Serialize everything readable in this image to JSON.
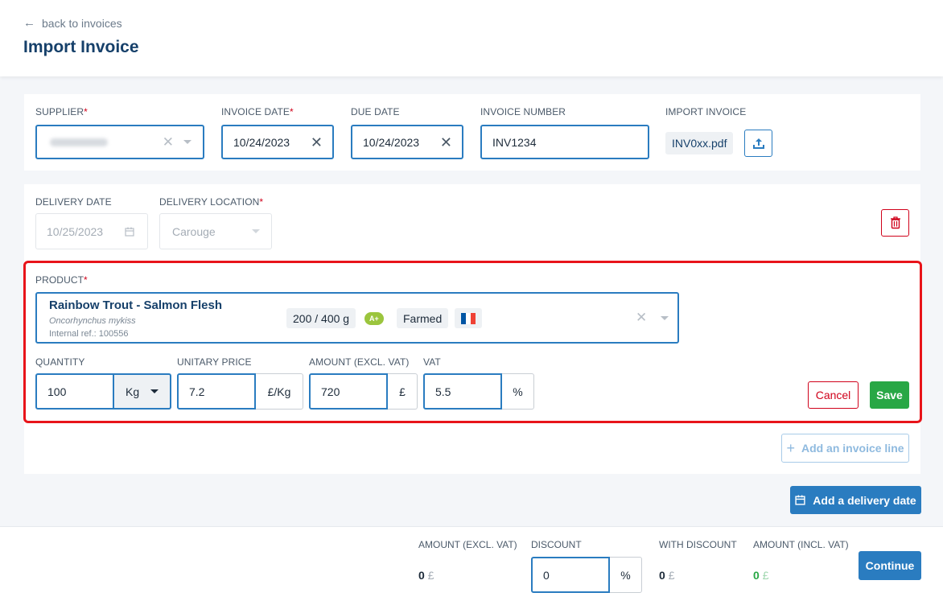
{
  "header": {
    "back_label": "back to invoices",
    "title": "Import Invoice"
  },
  "invoice": {
    "supplier_label": "SUPPLIER",
    "invoice_date_label": "INVOICE DATE",
    "invoice_date": "10/24/2023",
    "due_date_label": "DUE DATE",
    "due_date": "10/24/2023",
    "invoice_number_label": "INVOICE NUMBER",
    "invoice_number": "INV1234",
    "import_label": "IMPORT INVOICE",
    "file_name": "INV0xx.pdf",
    "required_mark": "*"
  },
  "delivery": {
    "date_label": "DELIVERY DATE",
    "date": "10/25/2023",
    "location_label": "DELIVERY LOCATION",
    "location": "Carouge"
  },
  "product": {
    "label": "PRODUCT",
    "name": "Rainbow Trout - Salmon Flesh",
    "latin_name": "Oncorhynchus mykiss",
    "internal_ref": "Internal ref.: 100556",
    "size": "200 / 400 g",
    "grade": "A+",
    "method": "Farmed",
    "origin_flag_colors": [
      "#0055a4",
      "#ffffff",
      "#ef4135"
    ]
  },
  "line": {
    "quantity_label": "QUANTITY",
    "quantity": "100",
    "unit": "Kg",
    "price_label": "UNITARY PRICE",
    "price": "7.2",
    "price_unit": "£/Kg",
    "amount_label": "AMOUNT (EXCL. VAT)",
    "amount": "720",
    "amount_unit": "£",
    "vat_label": "VAT",
    "vat": "5.5",
    "vat_unit": "%"
  },
  "actions": {
    "cancel": "Cancel",
    "save": "Save",
    "add_line": "Add an invoice line",
    "add_delivery_date": "Add a delivery date",
    "continue": "Continue"
  },
  "totals": {
    "amount_excl_label": "AMOUNT (EXCL. VAT)",
    "amount_excl": "0",
    "discount_label": "DISCOUNT",
    "discount": "0",
    "discount_unit": "%",
    "with_discount_label": "WITH DISCOUNT",
    "with_discount": "0",
    "amount_incl_label": "AMOUNT (INCL. VAT)",
    "amount_incl": "0",
    "currency": "£"
  },
  "colors": {
    "primary": "#2a7cc0",
    "title": "#16406a",
    "danger": "#d0021b",
    "success": "#28a745",
    "highlight": "#e8141a"
  }
}
